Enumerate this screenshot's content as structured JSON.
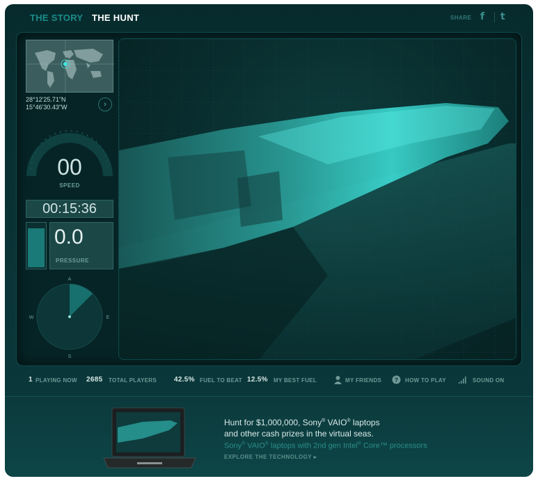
{
  "nav": {
    "story": "THE STORY",
    "hunt": "THE HUNT",
    "share": "SHARE",
    "facebook_icon": "facebook-icon",
    "twitter_icon": "twitter-icon"
  },
  "instruments": {
    "coord_lat": "28°12'25.71\"N",
    "coord_lon": "15°46'30.43\"W",
    "speed_value": "00",
    "speed_label": "SPEED",
    "timer": "00:15:36",
    "pressure_value": "0.0",
    "pressure_label": "PRESSURE",
    "fuel_level": 0.9,
    "compass": {
      "n": "A",
      "w": "W",
      "e": "E",
      "s": "S"
    }
  },
  "stats": {
    "playing_now_value": "1",
    "playing_now_label": "PLAYING NOW",
    "total_players_value": "2685",
    "total_players_label": "TOTAL PLAYERS",
    "fuel_to_beat_value": "42.5%",
    "fuel_to_beat_label": "FUEL TO BEAT",
    "best_fuel_value": "12.5%",
    "best_fuel_label": "MY BEST FUEL",
    "friends_label": "MY FRIENDS",
    "how_to_play_label": "HOW TO PLAY",
    "sound_label": "SOUND ON"
  },
  "promo": {
    "line1_a": "Hunt for $1,000,000, Sony",
    "line1_b": " VAIO",
    "line1_c": " laptops",
    "line2": "and other cash prizes in the virtual seas.",
    "line3_a": "Sony",
    "line3_b": " VAIO",
    "line3_c": " laptops with 2nd gen Intel",
    "line3_d": " Core™ processors",
    "reg": "®",
    "link": "EXPLORE THE TECHNOLOGY ▸"
  },
  "colors": {
    "accent": "#1a8d8a",
    "panel": "#062426",
    "sonar": "#3fe3dc"
  }
}
